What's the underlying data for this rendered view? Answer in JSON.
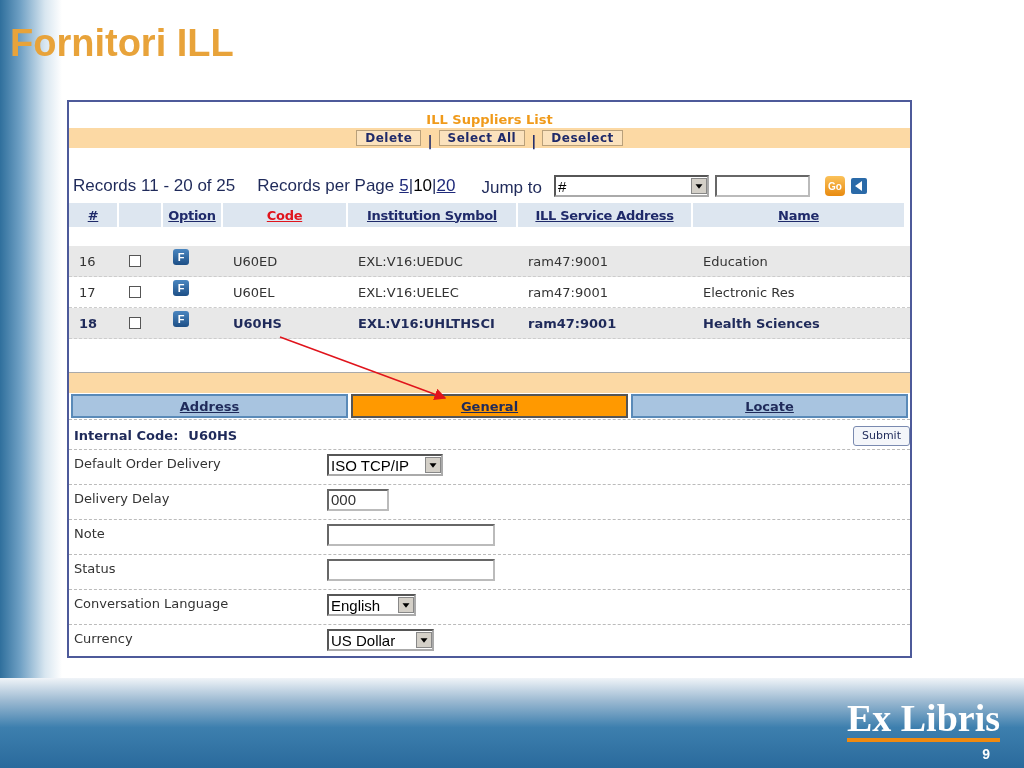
{
  "slide": {
    "title": "Fornitori ILL",
    "logo": "Ex Libris",
    "page_number": "9"
  },
  "panel": {
    "title": "ILL Suppliers List",
    "toolbar": [
      {
        "kind": "button",
        "label": "Delete"
      },
      {
        "kind": "separator",
        "label": "|"
      },
      {
        "kind": "button",
        "label": "Select All"
      },
      {
        "kind": "separator",
        "label": "|"
      },
      {
        "kind": "button",
        "label": "Deselect"
      }
    ],
    "records": "Records 11 - 20 of 25",
    "per_page_label": "Records per Page",
    "page_sizes": [
      {
        "label": "5",
        "selected": false
      },
      {
        "label": "10",
        "selected": true
      },
      {
        "label": "20",
        "selected": false
      }
    ],
    "page_size_separators": [
      "|",
      "|"
    ],
    "jump_label": "Jump to",
    "jump_select": "#",
    "go": "Go",
    "columns": [
      {
        "label": "#",
        "sorted": false
      },
      {
        "sorted": false
      },
      {
        "label": "Option",
        "sorted": false
      },
      {
        "label": "Code",
        "sorted": true
      },
      {
        "label": "Institution Symbol",
        "sorted": false
      },
      {
        "label": "ILL Service Address",
        "sorted": false
      },
      {
        "label": "Name",
        "sorted": false
      }
    ],
    "rows": [
      {
        "num": "16",
        "checked": false,
        "option": "F",
        "code": "U60ED",
        "symbol": "EXL:V16:UEDUC",
        "address": "ram47:9001",
        "name": "Education",
        "selected": false
      },
      {
        "num": "17",
        "checked": false,
        "option": "F",
        "code": "U60EL",
        "symbol": "EXL:V16:UELEC",
        "address": "ram47:9001",
        "name": "Electronic Res",
        "selected": false
      },
      {
        "num": "18",
        "checked": false,
        "option": "F",
        "code": "U60HS",
        "symbol": "EXL:V16:UHLTHSCI",
        "address": "ram47:9001",
        "name": "Health Sciences",
        "selected": true
      }
    ],
    "tabs": [
      {
        "label": "Address",
        "selected": false
      },
      {
        "label": "General",
        "selected": true
      },
      {
        "label": "Locate",
        "selected": false
      }
    ],
    "internal_code_label": "Internal Code:",
    "internal_code": "U60HS",
    "submit": "Submit",
    "fields": [
      {
        "label": "Default Order Delivery",
        "kind": "select",
        "value": "ISO TCP/IP"
      },
      {
        "label": "Delivery Delay",
        "kind": "short",
        "value": "000"
      },
      {
        "label": "Note",
        "kind": "text"
      },
      {
        "label": "Status",
        "kind": "text"
      },
      {
        "label": "Conversation Language",
        "kind": "select",
        "value": "English"
      },
      {
        "label": "Currency",
        "kind": "select",
        "value": "US Dollar"
      }
    ]
  }
}
